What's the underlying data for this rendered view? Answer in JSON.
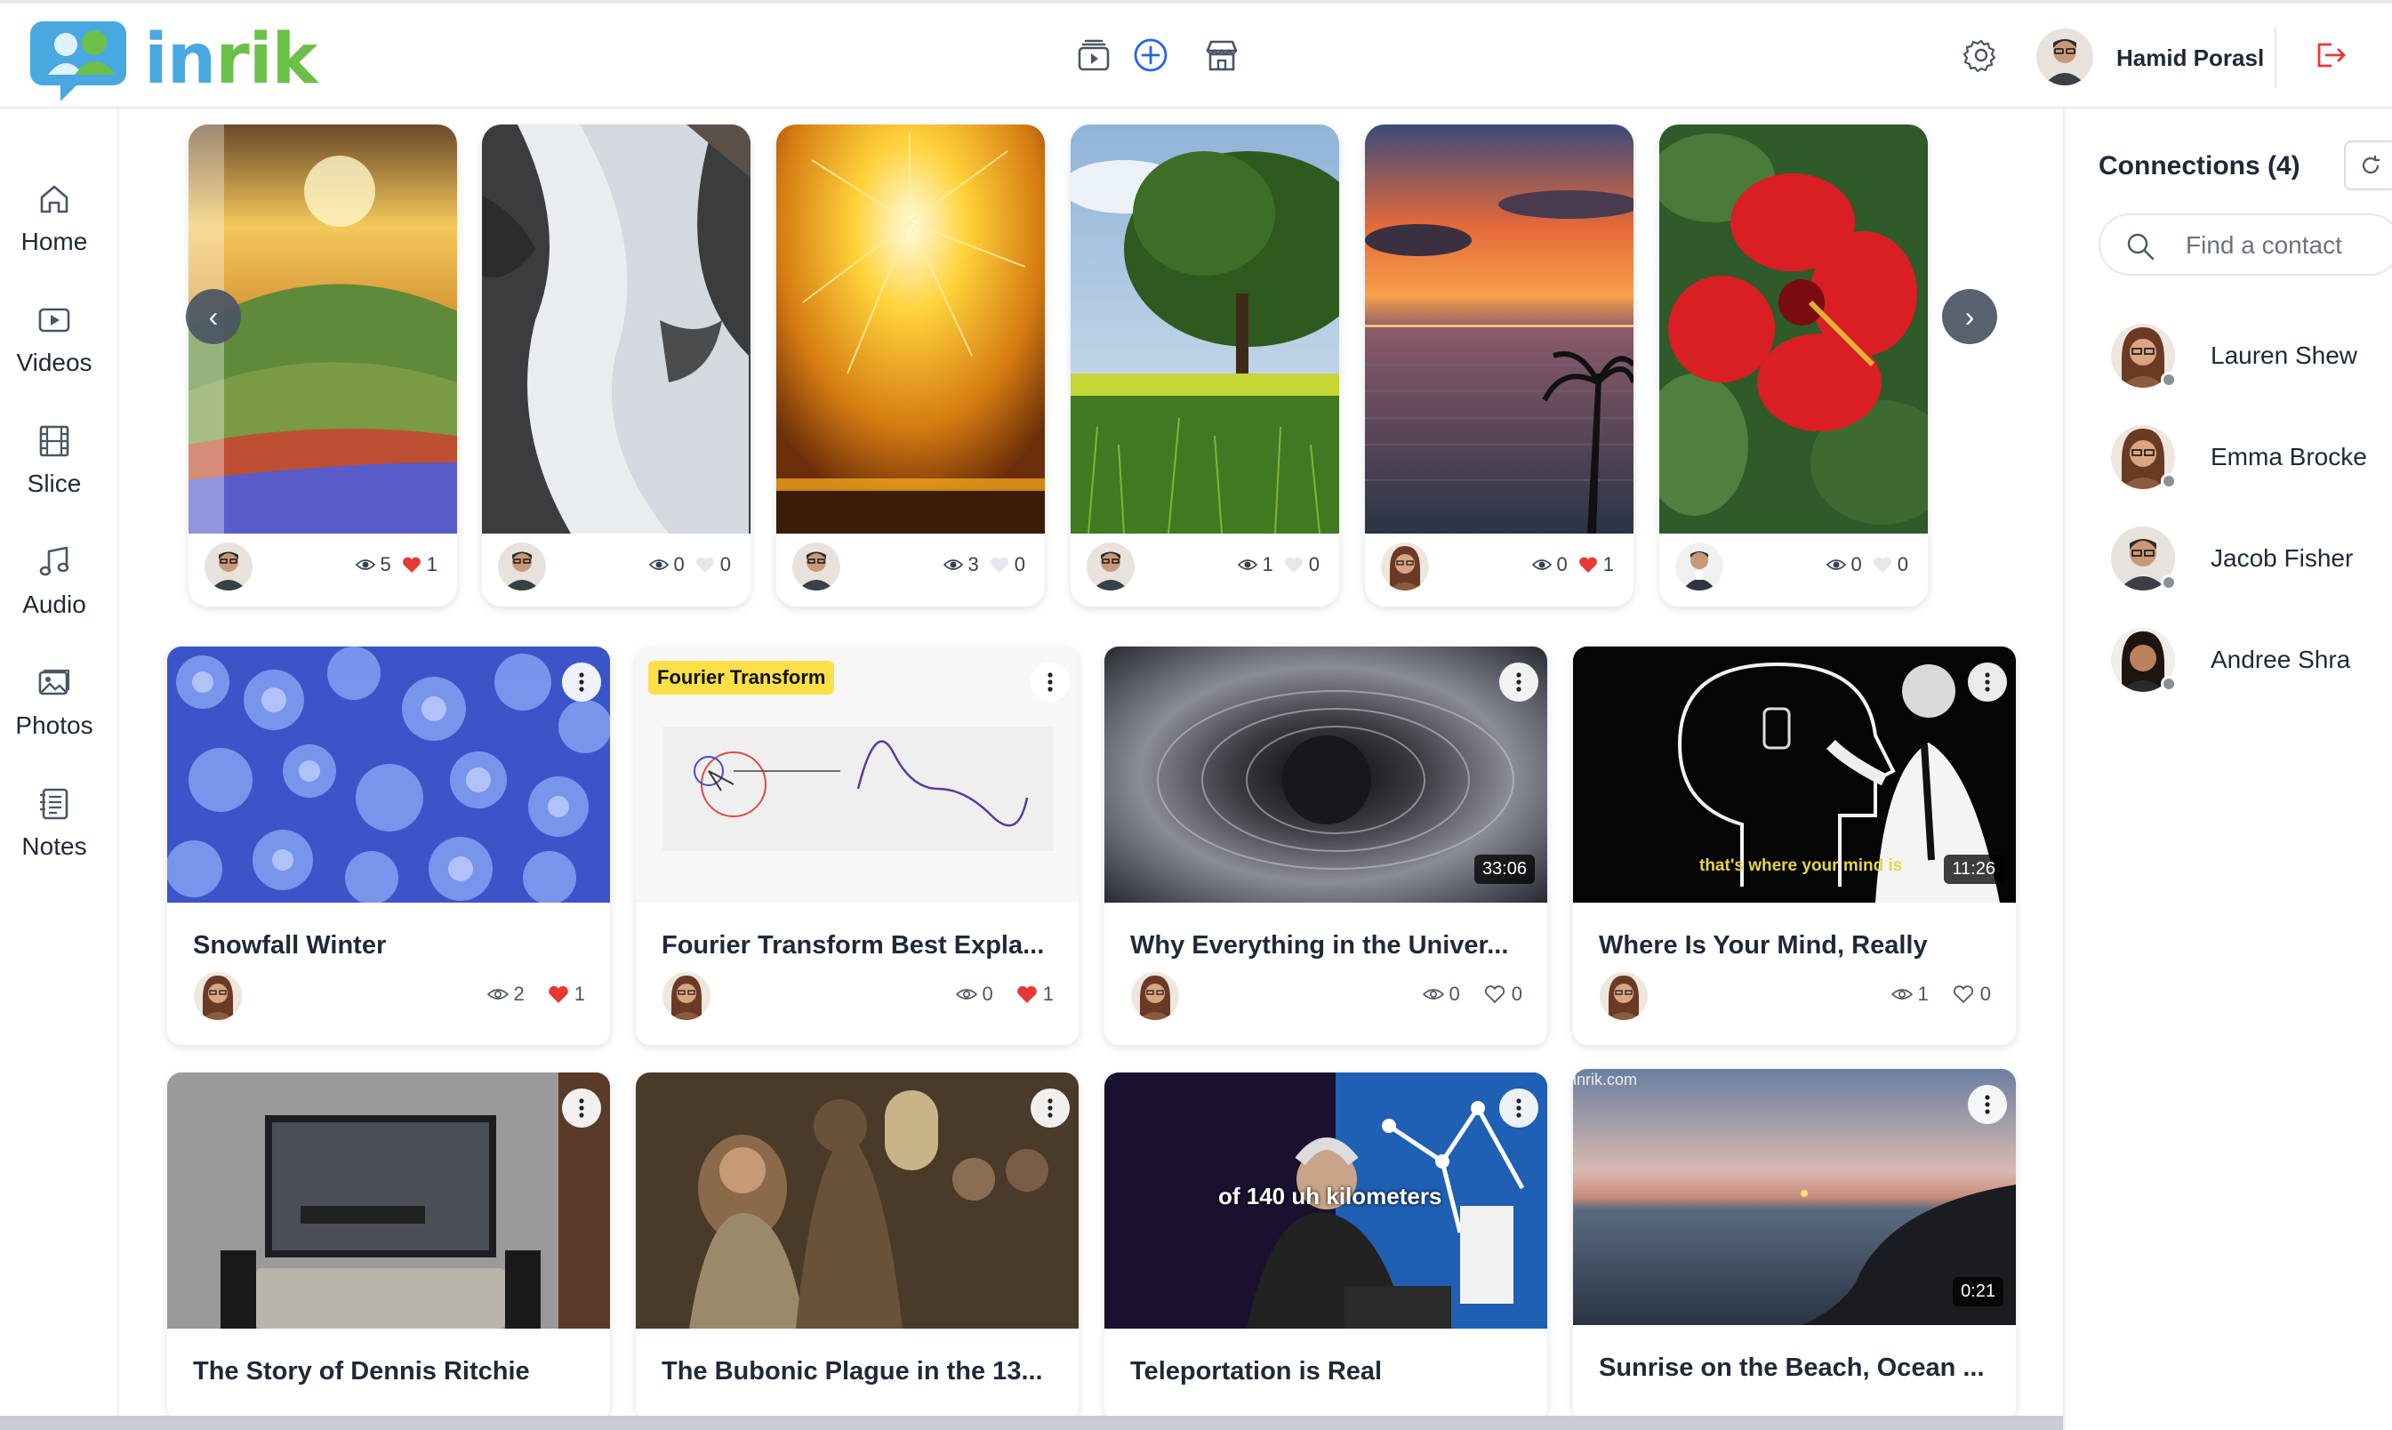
{
  "app": {
    "brand": {
      "prefix": "in",
      "suffix": "rik"
    },
    "user_name": "Hamid Porasl"
  },
  "header_icons": [
    "video-library-icon",
    "create-plus-icon",
    "store-icon",
    "settings-gear-icon",
    "logout-icon"
  ],
  "sidebar": {
    "items": [
      {
        "label": "Home",
        "icon": "home-icon"
      },
      {
        "label": "Videos",
        "icon": "video-icon"
      },
      {
        "label": "Slice",
        "icon": "film-icon"
      },
      {
        "label": "Audio",
        "icon": "music-note-icon"
      },
      {
        "label": "Photos",
        "icon": "photos-icon"
      },
      {
        "label": "Notes",
        "icon": "notes-icon"
      }
    ]
  },
  "connections": {
    "title": "Connections (4)",
    "search_placeholder": "Find a contact",
    "contacts": [
      {
        "name": "Lauren Shew"
      },
      {
        "name": "Emma Brocke"
      },
      {
        "name": "Jacob Fisher"
      },
      {
        "name": "Andree Shra"
      }
    ]
  },
  "stories": [
    {
      "views": "5",
      "likes": "1",
      "liked": true
    },
    {
      "views": "0",
      "likes": "0",
      "liked": false
    },
    {
      "views": "3",
      "likes": "0",
      "liked": false
    },
    {
      "views": "1",
      "likes": "0",
      "liked": false
    },
    {
      "views": "0",
      "likes": "1",
      "liked": true
    },
    {
      "views": "0",
      "likes": "0",
      "liked": false
    }
  ],
  "videos": [
    {
      "title": "Snowfall Winter",
      "views": "2",
      "likes": "1",
      "liked": true,
      "duration": "",
      "tag": ""
    },
    {
      "title": "Fourier Transform Best Expla...",
      "views": "0",
      "likes": "1",
      "liked": true,
      "duration": "",
      "tag": "Fourier Transform"
    },
    {
      "title": "Why Everything in the Univer...",
      "views": "0",
      "likes": "0",
      "liked": false,
      "duration": "33:06",
      "tag": ""
    },
    {
      "title": "Where Is Your Mind, Really",
      "views": "1",
      "likes": "0",
      "liked": false,
      "duration": "11:26",
      "tag": "",
      "caption": "that's where your mind is"
    },
    {
      "title": "The Story of Dennis Ritchie",
      "duration": "",
      "tag": ""
    },
    {
      "title": "The Bubonic Plague in the 13...",
      "duration": "",
      "tag": ""
    },
    {
      "title": "Teleportation is Real",
      "duration": "",
      "tag": "",
      "caption": "of 140 uh kilometers"
    },
    {
      "title": "Sunrise on the Beach, Ocean ...",
      "duration": "0:21",
      "tag": "",
      "watermark": "inrik.com"
    }
  ],
  "colors": {
    "brand_blue": "#4aa8e0",
    "brand_green": "#6cc04a",
    "like_red": "#e53935",
    "logout_red": "#e53935"
  }
}
